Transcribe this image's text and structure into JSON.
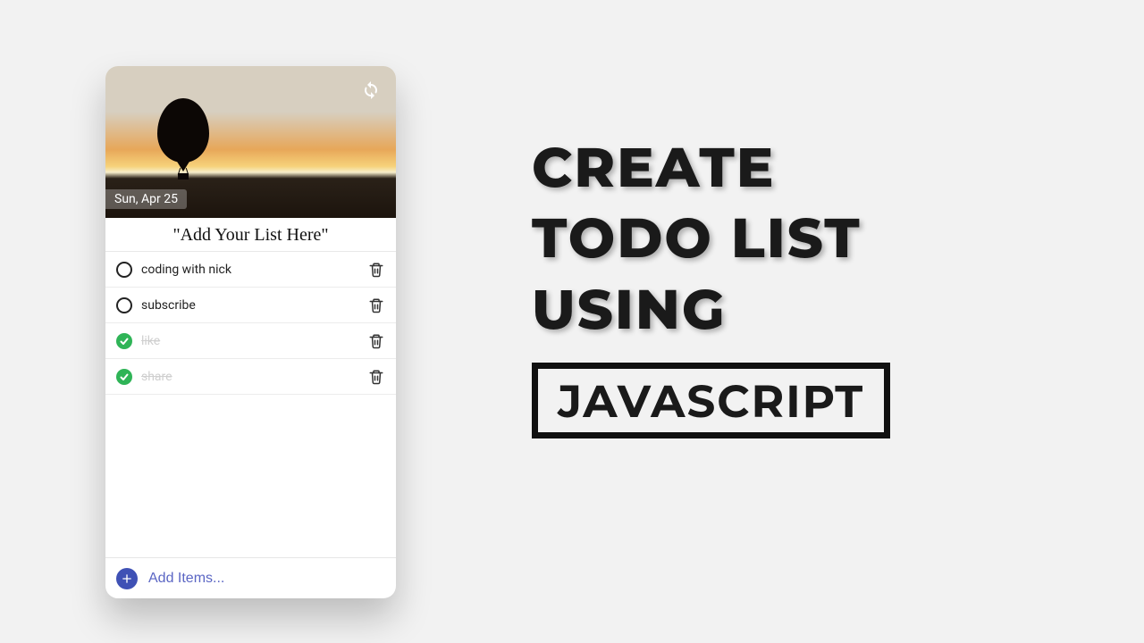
{
  "hero": {
    "date": "Sun, Apr 25",
    "refresh_icon": "refresh-icon"
  },
  "list": {
    "heading": "\"Add Your List Here\"",
    "items": [
      {
        "label": "coding with nick",
        "done": false
      },
      {
        "label": "subscribe",
        "done": false
      },
      {
        "label": "like",
        "done": true
      },
      {
        "label": "share",
        "done": true
      }
    ],
    "add_placeholder": "Add Items..."
  },
  "title": {
    "lines": [
      "CREATE",
      "TODO LIST",
      "USING"
    ],
    "boxed": "JAVASCRIPT"
  },
  "colors": {
    "accent": "#3f51b5",
    "done_check": "#2fb457"
  }
}
